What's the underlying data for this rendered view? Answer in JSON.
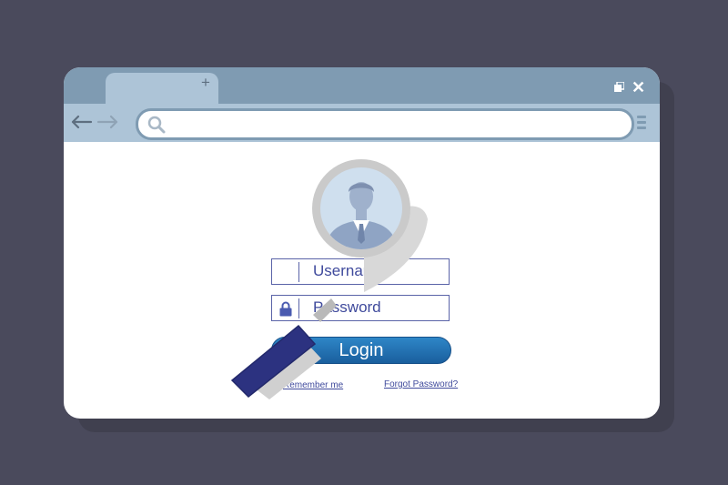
{
  "browser": {
    "new_tab_label": "+",
    "close_label": "✕",
    "back_icon": "arrow-left-icon",
    "forward_icon": "arrow-right-icon",
    "search_icon": "search-icon",
    "menu_icon": "hamburger-icon",
    "address_value": "",
    "colors": {
      "background": "#4a4a5c",
      "titlebar": "#7f9bb2",
      "toolbar": "#adc4d7",
      "accent": "#3f4a9c",
      "button": "#1f6eb0"
    }
  },
  "login": {
    "username_placeholder": "Username",
    "password_placeholder": "Password",
    "login_label": "Login",
    "remember_label": "Remember me",
    "forgot_label": "Forgot Password?"
  },
  "illustration": {
    "magnifier_icon": "magnifying-glass-icon",
    "avatar": "user-avatar"
  }
}
